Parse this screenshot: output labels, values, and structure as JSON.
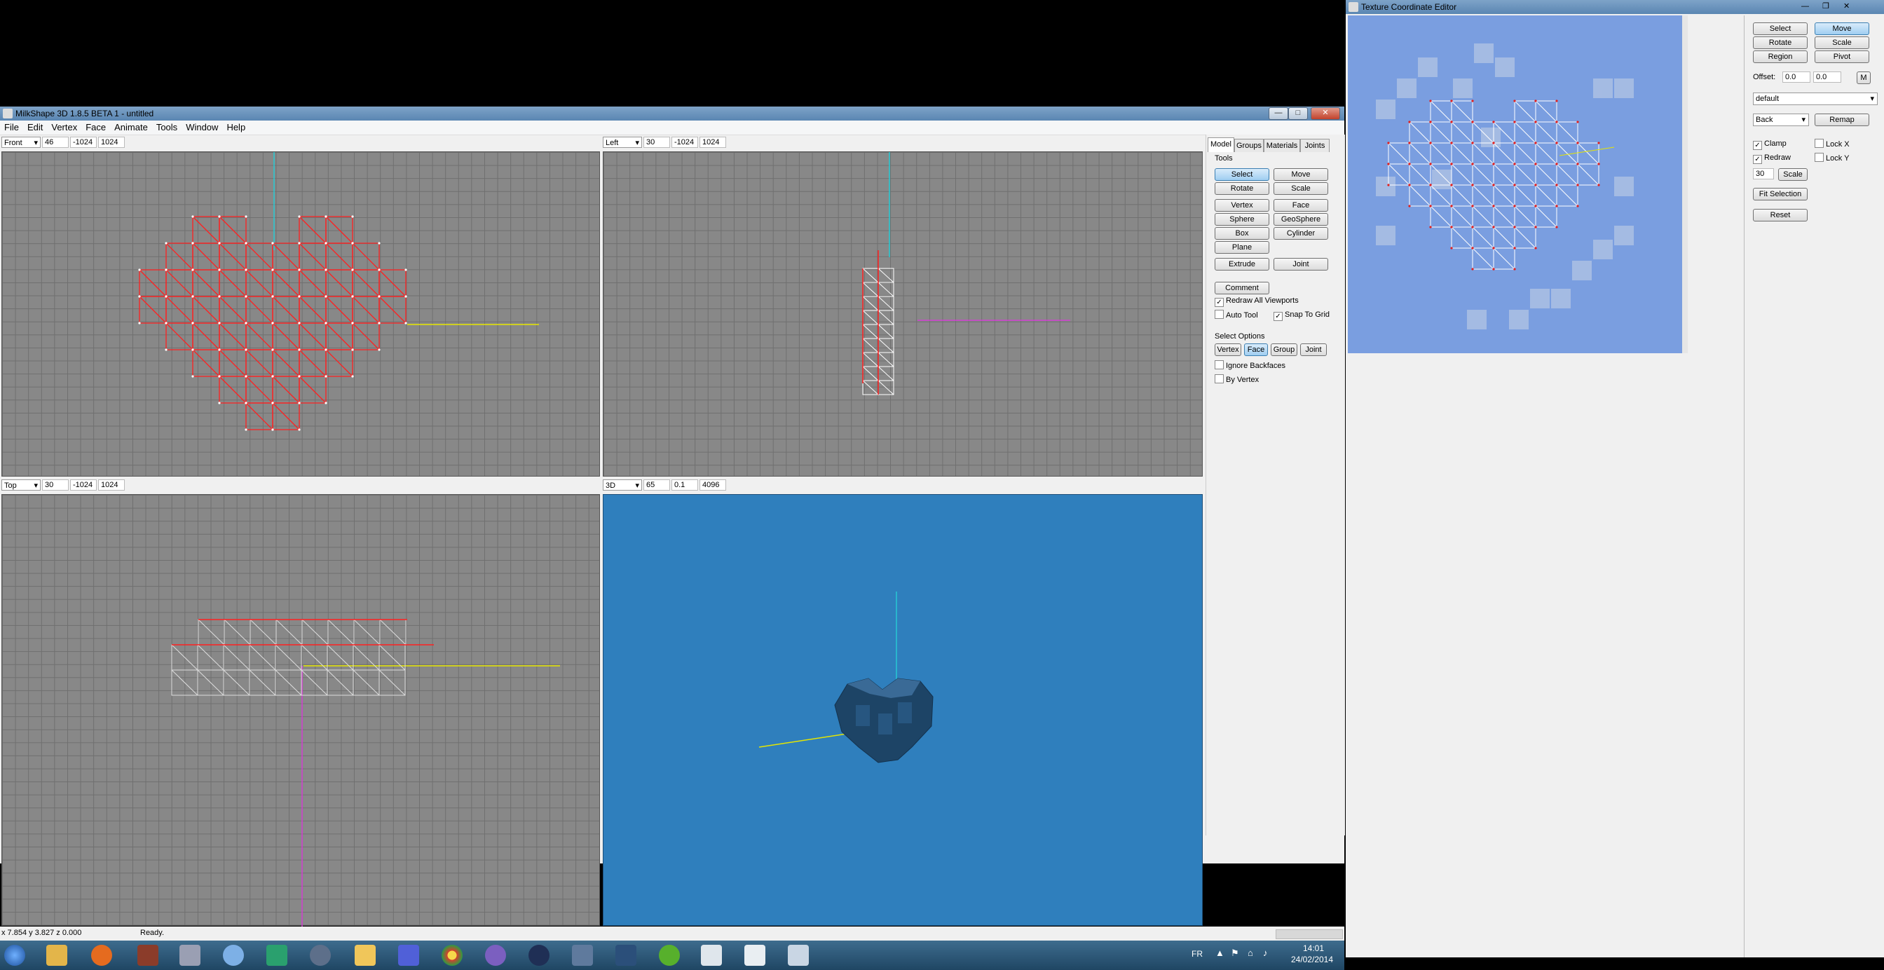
{
  "main_window": {
    "title": "MilkShape 3D 1.8.5 BETA 1 - untitled",
    "title_buttons": {
      "minimize": "—",
      "maximize": "□",
      "close": "✕"
    },
    "menu": [
      "File",
      "Edit",
      "Vertex",
      "Face",
      "Animate",
      "Tools",
      "Window",
      "Help"
    ]
  },
  "viewports": {
    "front": {
      "view": "Front",
      "fov": "46",
      "near": "-1024",
      "far": "1024"
    },
    "left": {
      "view": "Left",
      "fov": "30",
      "near": "-1024",
      "far": "1024"
    },
    "top": {
      "view": "Top",
      "fov": "30",
      "near": "-1024",
      "far": "1024"
    },
    "persp": {
      "view": "3D",
      "fov": "65",
      "near": "0.1",
      "far": "4096"
    }
  },
  "panel": {
    "tabs": [
      "Model",
      "Groups",
      "Materials",
      "Joints"
    ],
    "tools_label": "Tools",
    "tools": [
      "Select",
      "Move",
      "Rotate",
      "Scale",
      "Vertex",
      "Face",
      "Sphere",
      "GeoSphere",
      "Box",
      "Cylinder",
      "Plane",
      "Extrude",
      "Joint",
      "Comment"
    ],
    "options": {
      "redraw_all": "Redraw All Viewports",
      "auto_tool": "Auto Tool",
      "snap_grid": "Snap To Grid"
    },
    "select_options_label": "Select Options",
    "select_modes": [
      "Vertex",
      "Face",
      "Group",
      "Joint"
    ],
    "ignore_backfaces": "Ignore Backfaces",
    "by_vertex": "By Vertex"
  },
  "status": {
    "coords": "x 7.854 y 3.827 z 0.000",
    "message": "Ready."
  },
  "taskbar": {
    "lang": "FR",
    "time": "14:01",
    "date": "24/02/2014"
  },
  "texture_editor": {
    "title": "Texture Coordinate Editor",
    "buttons": [
      "Select",
      "Move",
      "Rotate",
      "Scale",
      "Region",
      "Pivot"
    ],
    "offset_label": "Offset:",
    "offset_x": "0.0",
    "offset_y": "0.0",
    "offset_m": "M",
    "material": "default",
    "projection": "Back",
    "remap": "Remap",
    "clamp": "Clamp",
    "lock_x": "Lock X",
    "redraw": "Redraw",
    "lock_y": "Lock Y",
    "scale_value": "30",
    "scale_btn": "Scale",
    "fit_selection": "Fit Selection",
    "reset": "Reset"
  },
  "colors": {
    "persp_bg": "#2f7fbd",
    "grid_bg": "#888888",
    "accent_red": "#e02020",
    "axis_yellow": "#e6e600",
    "axis_cyan": "#26c9d4",
    "axis_magenta": "#d23fd2"
  }
}
